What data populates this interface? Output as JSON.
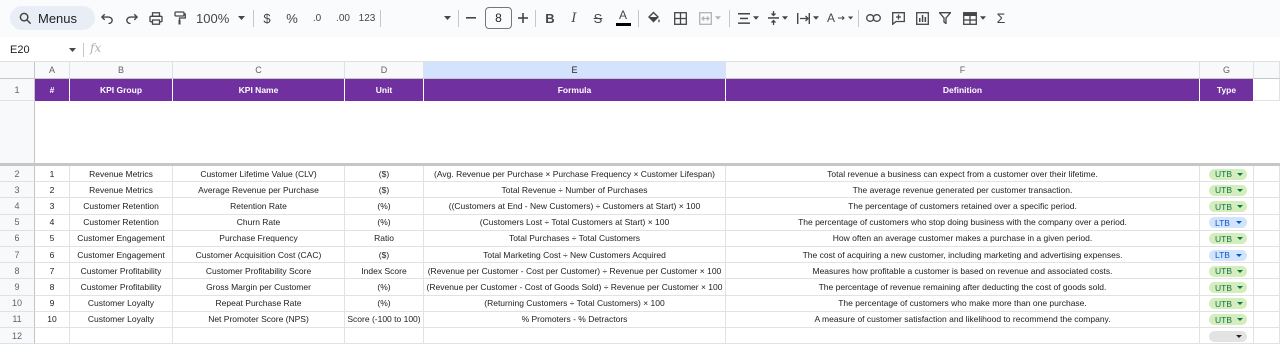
{
  "toolbar": {
    "menus_label": "Menus",
    "zoom": "100%",
    "currency": "$",
    "percent": "%",
    "decrease_decimal": ".0",
    "increase_decimal": ".00",
    "number_format": "123",
    "font_size": "8"
  },
  "formula_bar": {
    "name_box": "E20",
    "fx_label": "fx",
    "formula": ""
  },
  "columns": [
    "A",
    "B",
    "C",
    "D",
    "E",
    "F",
    "G"
  ],
  "selected_column": "E",
  "row_numbers": [
    "1",
    "2",
    "3",
    "4",
    "5",
    "6",
    "7",
    "8",
    "9",
    "10",
    "11",
    "12"
  ],
  "header_row": [
    "#",
    "KPI Group",
    "KPI Name",
    "Unit",
    "Formula",
    "Definition",
    "Type"
  ],
  "rows": [
    {
      "num": "1",
      "group": "Revenue Metrics",
      "name": "Customer Lifetime Value (CLV)",
      "unit": "($)",
      "formula": "(Avg. Revenue per Purchase × Purchase Frequency × Customer Lifespan)",
      "definition": "Total revenue a business can expect from a customer over their lifetime.",
      "type": "UTB"
    },
    {
      "num": "2",
      "group": "Revenue Metrics",
      "name": "Average Revenue per Purchase",
      "unit": "($)",
      "formula": "Total Revenue ÷ Number of Purchases",
      "definition": "The average revenue generated per customer transaction.",
      "type": "UTB"
    },
    {
      "num": "3",
      "group": "Customer Retention",
      "name": "Retention Rate",
      "unit": "(%)",
      "formula": "((Customers at End - New Customers) ÷ Customers at Start) × 100",
      "definition": "The percentage of customers retained over a specific period.",
      "type": "UTB"
    },
    {
      "num": "4",
      "group": "Customer Retention",
      "name": "Churn Rate",
      "unit": "(%)",
      "formula": "(Customers Lost ÷ Total Customers at Start) × 100",
      "definition": "The percentage of customers who stop doing business with the company over a period.",
      "type": "LTB"
    },
    {
      "num": "5",
      "group": "Customer Engagement",
      "name": "Purchase Frequency",
      "unit": "Ratio",
      "formula": "Total Purchases ÷ Total Customers",
      "definition": "How often an average customer makes a purchase in a given period.",
      "type": "UTB"
    },
    {
      "num": "6",
      "group": "Customer Engagement",
      "name": "Customer Acquisition Cost (CAC)",
      "unit": "($)",
      "formula": "Total Marketing Cost ÷ New Customers Acquired",
      "definition": "The cost of acquiring a new customer, including marketing and advertising expenses.",
      "type": "LTB"
    },
    {
      "num": "7",
      "group": "Customer Profitability",
      "name": "Customer Profitability Score",
      "unit": "Index Score",
      "formula": "(Revenue per Customer - Cost per Customer) ÷ Revenue per Customer × 100",
      "definition": "Measures how profitable a customer is based on revenue and associated costs.",
      "type": "UTB"
    },
    {
      "num": "8",
      "group": "Customer Profitability",
      "name": "Gross Margin per Customer",
      "unit": "(%)",
      "formula": "(Revenue per Customer - Cost of Goods Sold) ÷ Revenue per Customer × 100",
      "definition": "The percentage of revenue remaining after deducting the cost of goods sold.",
      "type": "UTB"
    },
    {
      "num": "9",
      "group": "Customer Loyalty",
      "name": "Repeat Purchase Rate",
      "unit": "(%)",
      "formula": "(Returning Customers ÷ Total Customers) × 100",
      "definition": "The percentage of customers who make more than one purchase.",
      "type": "UTB"
    },
    {
      "num": "10",
      "group": "Customer Loyalty",
      "name": "Net Promoter Score (NPS)",
      "unit": "Score (-100 to 100)",
      "formula": "% Promoters - % Detractors",
      "definition": "A measure of customer satisfaction and likelihood to recommend the company.",
      "type": "UTB"
    }
  ],
  "colors": {
    "header_bg": "#7030a0",
    "header_text": "#ffffff",
    "utb_chip": "#d4edbc",
    "ltb_chip": "#d2e3fc",
    "selected_column": "#d3e3fd"
  }
}
